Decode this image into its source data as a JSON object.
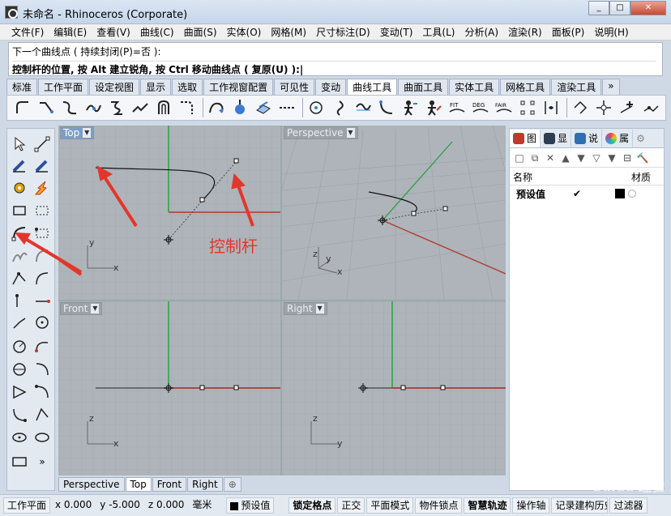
{
  "window": {
    "title": "未命名 - Rhinoceros (Corporate)",
    "min": "_",
    "max": "□",
    "close": "✕"
  },
  "menu": [
    "文件(F)",
    "编辑(E)",
    "查看(V)",
    "曲线(C)",
    "曲面(S)",
    "实体(O)",
    "网格(M)",
    "尺寸标注(D)",
    "变动(T)",
    "工具(L)",
    "分析(A)",
    "渲染(R)",
    "面板(P)",
    "说明(H)"
  ],
  "command": {
    "line1": "下一个曲线点 ( 持续封闭(P)=否 ):",
    "line2": "控制杆的位置, 按 Alt 建立锐角, 按 Ctrl 移动曲线点 ( 复原(U) ):|"
  },
  "tabs": [
    "标准",
    "工作平面",
    "设定视图",
    "显示",
    "选取",
    "工作视窗配置",
    "可见性",
    "变动",
    "曲线工具",
    "曲面工具",
    "实体工具",
    "网格工具",
    "渲染工具"
  ],
  "tabs_more": "»",
  "active_tab_index": 8,
  "viewports": {
    "top": {
      "label": "Top",
      "axis_x": "x",
      "axis_y": "y"
    },
    "perspective": {
      "label": "Perspective",
      "axis_x": "x",
      "axis_y": "y",
      "axis_z": "z"
    },
    "front": {
      "label": "Front",
      "axis_x": "x",
      "axis_y": "z"
    },
    "right": {
      "label": "Right",
      "axis_x": "y",
      "axis_y": "z"
    },
    "dropdown": "▼"
  },
  "viewport_tabs": [
    "Perspective",
    "Top",
    "Front",
    "Right"
  ],
  "active_viewport_tab": 1,
  "viewport_tab_add": "⊕",
  "annotation": {
    "text": "控制杆",
    "color": "#e3362b"
  },
  "right_panel": {
    "tabs": [
      {
        "label": "图",
        "icon": "layers-icon",
        "color": "#c0392b"
      },
      {
        "label": "显",
        "icon": "display-icon",
        "color": "#2c3e50"
      },
      {
        "label": "说",
        "icon": "help-icon",
        "color": "#2f6fb0"
      },
      {
        "label": "属",
        "icon": "properties-icon",
        "color": "#8e44ad"
      }
    ],
    "toolbar": [
      "□",
      "⧉",
      "✕",
      "▲",
      "▼",
      "▽",
      "▼",
      "⊟",
      "🔨"
    ],
    "header_name": "名称",
    "header_material": "材质",
    "rows": [
      {
        "name": "预设值",
        "check": "✔"
      }
    ]
  },
  "status": {
    "workplane": "工作平面",
    "x": "x 0.000",
    "y": "y -5.000",
    "z": "z 0.000",
    "unit": "毫米",
    "layer": "预设值",
    "snap": "锁定格点",
    "ortho": "正交",
    "planar": "平面模式",
    "osnap": "物件锁点",
    "smarttrack": "智慧轨迹",
    "gumball": "操作轴",
    "history": "记录建构历史",
    "filter": "过滤器"
  },
  "watermark": "Baidu 经验",
  "colors": {
    "accent": "#7c9ec7",
    "arrow": "#e3362b",
    "x_axis": "#b03a2e",
    "y_axis": "#2ea043"
  }
}
